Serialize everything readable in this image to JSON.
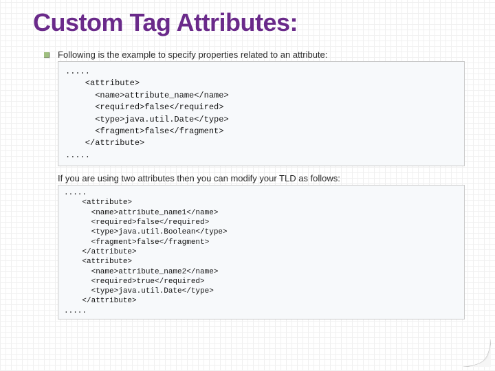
{
  "title": "Custom Tag Attributes:",
  "intro1": "Following is the example to specify properties related to an attribute:",
  "code1": ".....\n    <attribute>\n      <name>attribute_name</name>\n      <required>false</required>\n      <type>java.util.Date</type>\n      <fragment>false</fragment>\n    </attribute>\n.....",
  "intro2": "If you are using two attributes then you can modify your TLD as follows:",
  "code2": ".....\n    <attribute>\n      <name>attribute_name1</name>\n      <required>false</required>\n      <type>java.util.Boolean</type>\n      <fragment>false</fragment>\n    </attribute>\n    <attribute>\n      <name>attribute_name2</name>\n      <required>true</required>\n      <type>java.util.Date</type>\n    </attribute>\n....."
}
